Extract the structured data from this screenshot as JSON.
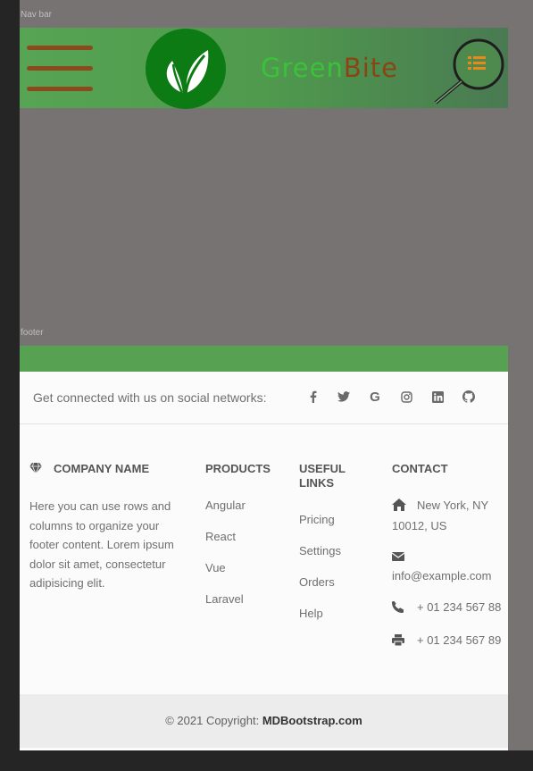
{
  "captions": {
    "nav": "Nav bar",
    "footer": "footer"
  },
  "navbar": {
    "brand_part1": "Green",
    "brand_part2": "Bite",
    "colors": {
      "brand_green": "#3cc13a",
      "brand_brown": "#8b4513",
      "bar_green": "#57a454"
    }
  },
  "footer": {
    "social_text": "Get connected with us on social networks:",
    "social_icons": [
      "facebook-icon",
      "twitter-icon",
      "google-icon",
      "instagram-icon",
      "linkedin-icon",
      "github-icon"
    ],
    "company": {
      "title": "COMPANY NAME",
      "text": "Here you can use rows and columns to organize your footer content. Lorem ipsum dolor sit amet, consectetur adipisicing elit."
    },
    "products": {
      "title": "PRODUCTS",
      "items": [
        "Angular",
        "React",
        "Vue",
        "Laravel"
      ]
    },
    "useful_links": {
      "title_line1": "USEFUL",
      "title_line2": "LINKS",
      "items": [
        "Pricing",
        "Settings",
        "Orders",
        "Help"
      ]
    },
    "contact": {
      "title": "CONTACT",
      "address": "New York, NY 10012, US",
      "email": "info@example.com",
      "phone": "+ 01 234 567 88",
      "fax": "+ 01 234 567 89"
    },
    "copyright_prefix": "© 2021 Copyright: ",
    "copyright_link": "MDBootstrap.com"
  }
}
